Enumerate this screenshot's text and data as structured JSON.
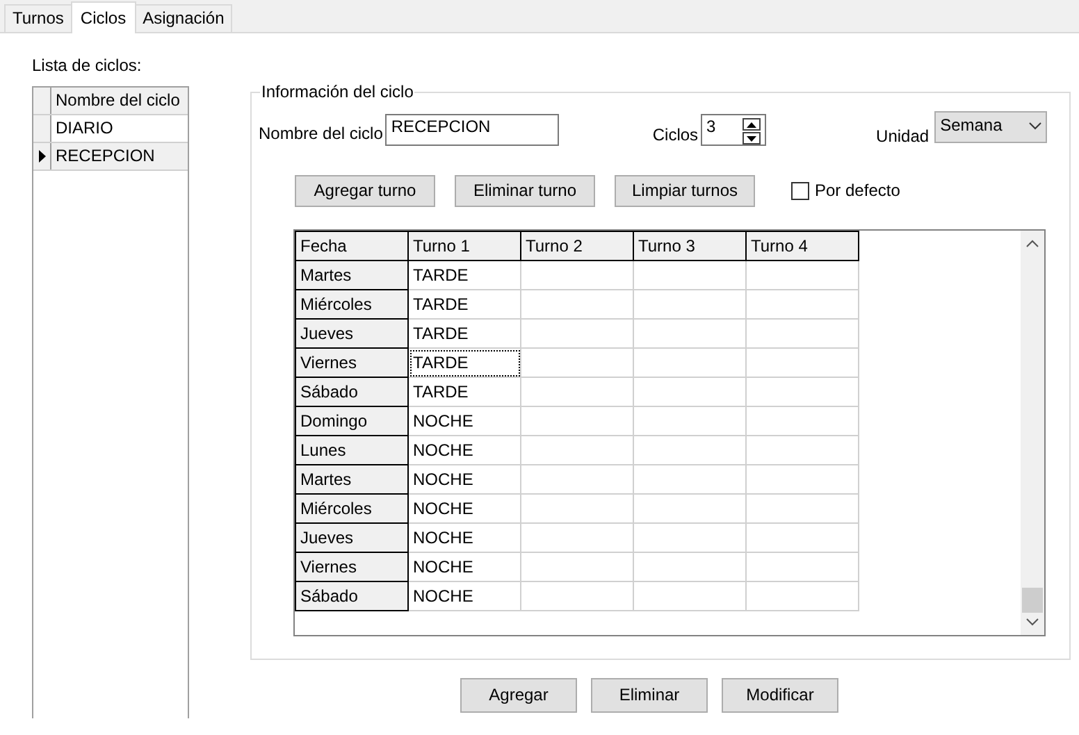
{
  "tabs": [
    {
      "label": "Turnos",
      "selected": false
    },
    {
      "label": "Ciclos",
      "selected": true
    },
    {
      "label": "Asignación",
      "selected": false
    }
  ],
  "cycle_list": {
    "label": "Lista de ciclos:",
    "column": "Nombre del ciclo",
    "rows": [
      {
        "name": "DIARIO",
        "selected": false
      },
      {
        "name": "RECEPCION",
        "selected": true
      }
    ]
  },
  "info": {
    "title": "Información del ciclo",
    "name_label": "Nombre del ciclo",
    "name_value": "RECEPCION",
    "cycles_label": "Ciclos",
    "cycles_value": "3",
    "unit_label": "Unidad",
    "unit_value": "Semana",
    "buttons": [
      "Agregar turno",
      "Eliminar turno",
      "Limpiar turnos"
    ],
    "default_checkbox": {
      "label": "Por defecto",
      "checked": false
    },
    "grid": {
      "columns": [
        "Fecha",
        "Turno 1",
        "Turno 2",
        "Turno 3",
        "Turno 4"
      ],
      "rows": [
        {
          "date": "Martes",
          "shifts": [
            {
              "text": "TARDE",
              "focused": false
            }
          ]
        },
        {
          "date": "Miércoles",
          "shifts": [
            {
              "text": "TARDE",
              "focused": false
            }
          ]
        },
        {
          "date": "Jueves",
          "shifts": [
            {
              "text": "TARDE",
              "focused": false
            }
          ]
        },
        {
          "date": "Viernes",
          "shifts": [
            {
              "text": "TARDE",
              "focused": true
            }
          ]
        },
        {
          "date": "Sábado",
          "shifts": [
            {
              "text": "TARDE",
              "focused": false
            }
          ]
        },
        {
          "date": "Domingo",
          "shifts": [
            {
              "text": "NOCHE",
              "focused": false
            }
          ]
        },
        {
          "date": "Lunes",
          "shifts": [
            {
              "text": "NOCHE",
              "focused": false
            }
          ]
        },
        {
          "date": "Martes",
          "shifts": [
            {
              "text": "NOCHE",
              "focused": false
            }
          ]
        },
        {
          "date": "Miércoles",
          "shifts": [
            {
              "text": "NOCHE",
              "focused": false
            }
          ]
        },
        {
          "date": "Jueves",
          "shifts": [
            {
              "text": "NOCHE",
              "focused": false
            }
          ]
        },
        {
          "date": "Viernes",
          "shifts": [
            {
              "text": "NOCHE",
              "focused": false
            }
          ]
        },
        {
          "date": "Sábado",
          "shifts": [
            {
              "text": "NOCHE",
              "focused": false
            }
          ]
        }
      ]
    }
  },
  "actions": [
    "Agregar",
    "Eliminar",
    "Modificar"
  ]
}
